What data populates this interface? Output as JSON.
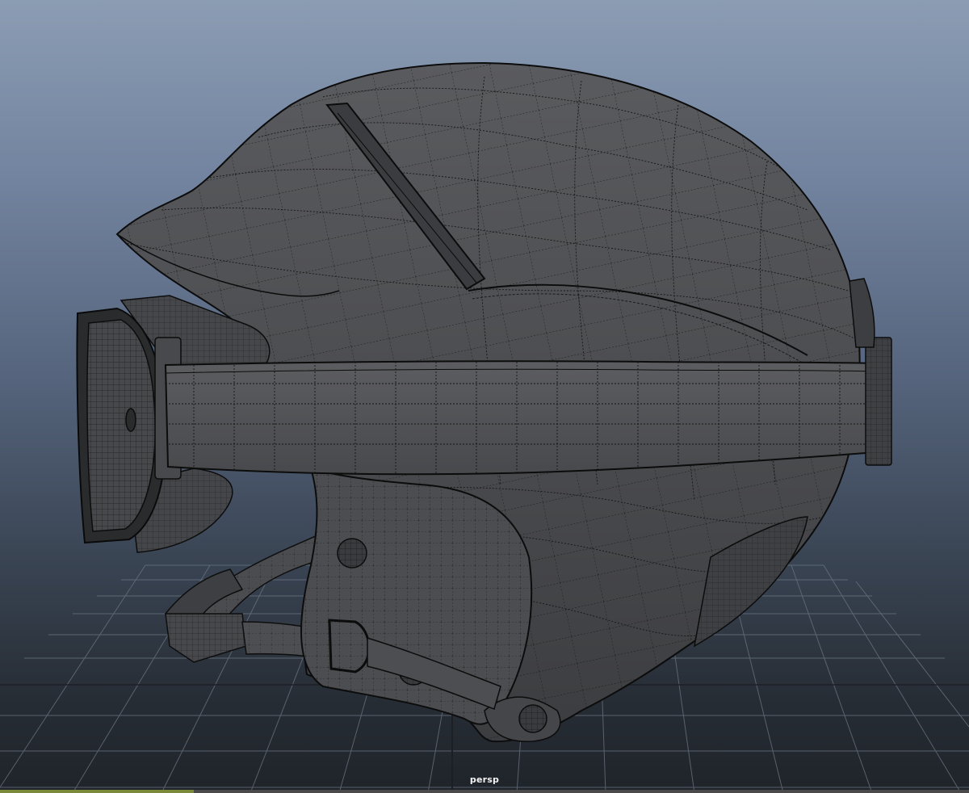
{
  "viewport": {
    "camera_label": "persp"
  },
  "colors": {
    "background_top": "#8b9cb3",
    "background_bottom": "#1f242a",
    "grid": "#6b7582",
    "mesh_fill": "#4a4b4e",
    "wire": "#121212"
  },
  "scene": {
    "object": "helmet-with-goggles",
    "display_mode": "wireframe-on-shaded"
  }
}
